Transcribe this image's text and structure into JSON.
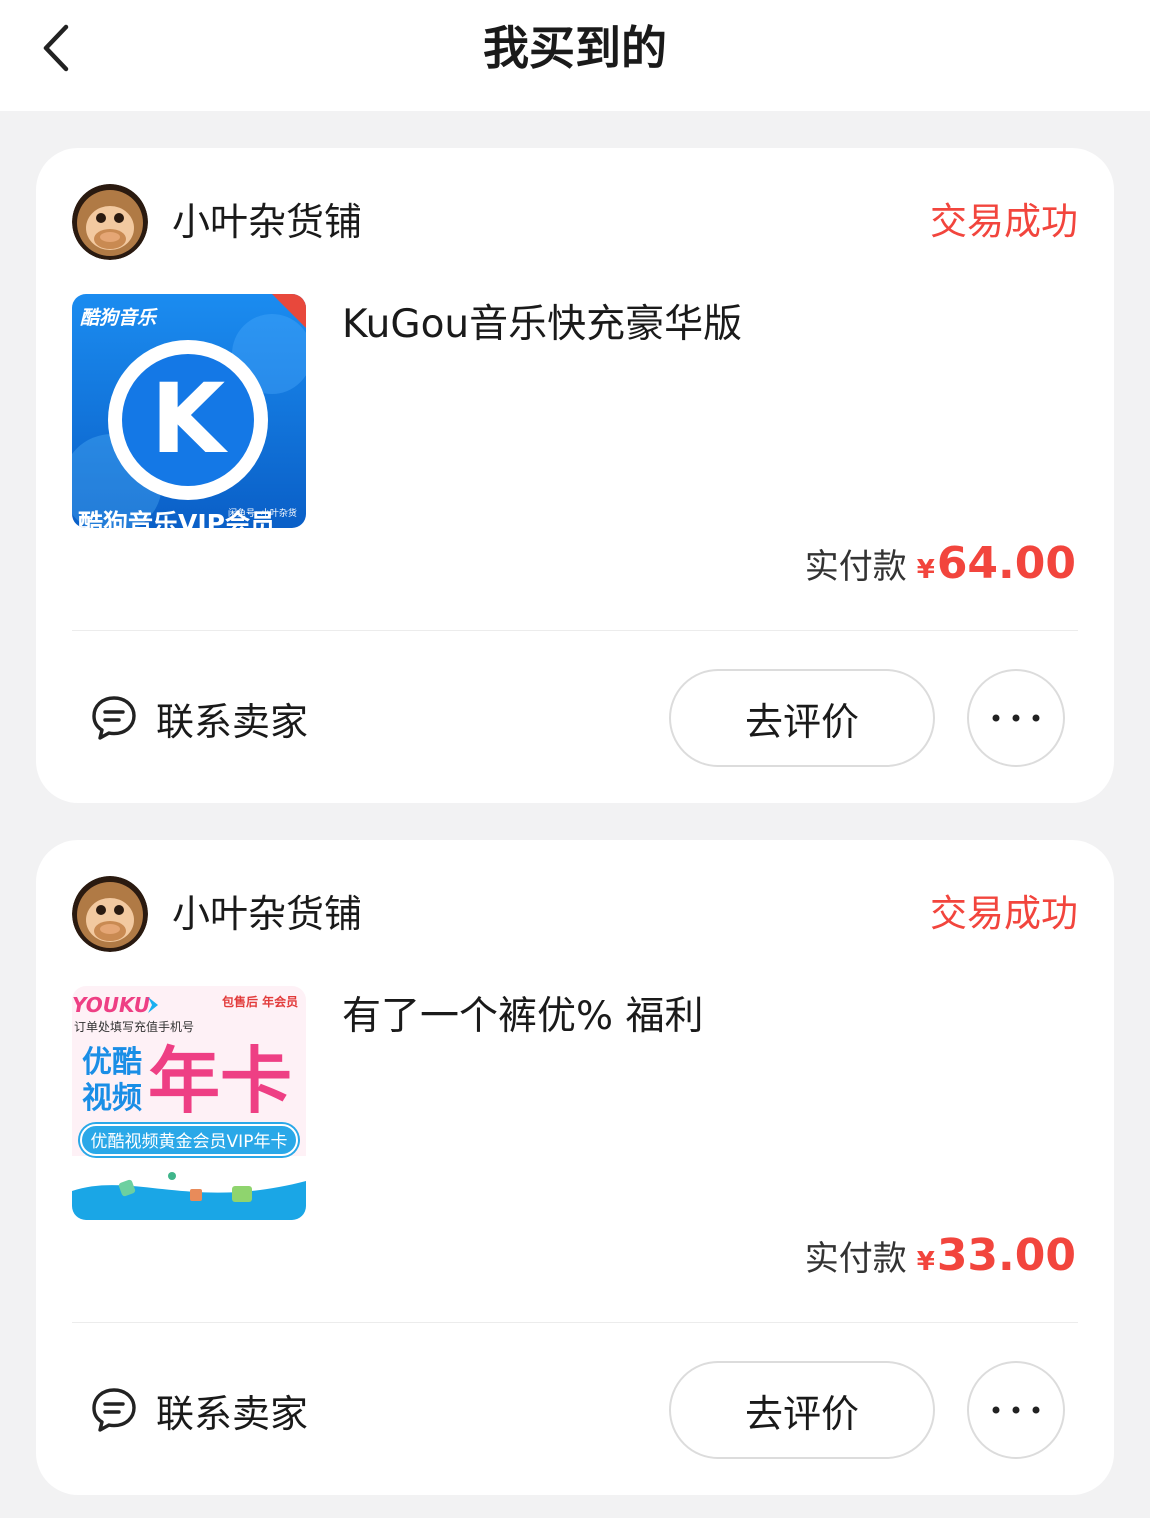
{
  "header": {
    "title": "我买到的",
    "back_icon": "chevron-left-icon"
  },
  "orders": [
    {
      "shop_name": "小叶杂货铺",
      "status": "交易成功",
      "product_title": "KuGou音乐快充豪华版",
      "thumbnail": {
        "brand": "酷狗音乐",
        "caption": "酷狗音乐VIP会员",
        "small_text": "闲鱼号: 小叶杂货",
        "letter": "K"
      },
      "price_label": "实付款",
      "currency": "¥",
      "price": "64.00",
      "contact_label": "联系卖家",
      "review_label": "去评价",
      "more_label": "···"
    },
    {
      "shop_name": "小叶杂货铺",
      "status": "交易成功",
      "product_title": "有了一个裤优% 福利",
      "thumbnail": {
        "brand": "YOUKU",
        "tag": "包售后 年会员",
        "hint": "订单处填写充值手机号",
        "name_line1": "优酷",
        "name_line2": "视频",
        "big_text": "年卡",
        "banner": "优酷视频黄金会员VIP年卡"
      },
      "price_label": "实付款",
      "currency": "¥",
      "price": "33.00",
      "contact_label": "联系卖家",
      "review_label": "去评价",
      "more_label": "···"
    }
  ],
  "colors": {
    "accent_red": "#f2453d",
    "background": "#f2f2f3",
    "kugou_blue": "#1478e6",
    "youku_pink": "#ee3f84"
  }
}
